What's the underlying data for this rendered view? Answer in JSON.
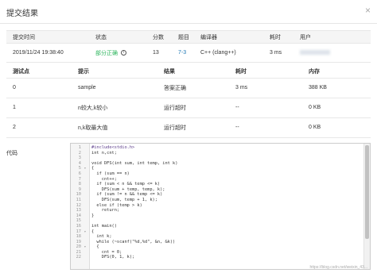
{
  "modal": {
    "title": "提交结果",
    "close": "×"
  },
  "submission": {
    "headers": [
      "提交时间",
      "状态",
      "分数",
      "题目",
      "编译器",
      "耗时",
      "用户"
    ],
    "time": "2019/11/24 19:38:40",
    "status": "部分正确",
    "info_icon": "i",
    "score": "13",
    "problem": "7-3",
    "compiler": "C++ (clang++)",
    "elapsed": "3 ms"
  },
  "cases": {
    "headers": [
      "测试点",
      "提示",
      "结果",
      "耗时",
      "内存"
    ],
    "rows": [
      {
        "id": "0",
        "hint": "sample",
        "result": "答案正确",
        "time": "3 ms",
        "memory": "388 KB"
      },
      {
        "id": "1",
        "hint": "n较大,k较小",
        "result": "运行超时",
        "time": "--",
        "memory": "0 KB"
      },
      {
        "id": "2",
        "hint": "n,k取最大值",
        "result": "运行超时",
        "time": "--",
        "memory": "0 KB"
      }
    ]
  },
  "code": {
    "label": "代码",
    "lines": [
      "#include<stdio.h>",
      "int n,cnt;",
      "",
      "void DFS(int sum, int temp, int k)",
      "{",
      "  if (sum == n)",
      "    cnt++;",
      "  if (sum < n && temp <= k)",
      "    DFS(sum + temp, temp, k);",
      "  if (sum != n && temp <= k)",
      "    DFS(sum, temp + 1, k);",
      "  else if (temp > k)",
      "    return;",
      "}",
      "",
      "int main()",
      "{",
      "  int k;",
      "  while (~scanf(\"%d,%d\", &n, &k))",
      "  {",
      "    cnt = 0;",
      "    DFS(0, 1, k);"
    ],
    "folds": [
      "",
      "",
      "",
      "",
      "▾",
      "",
      "",
      "",
      "",
      "",
      "",
      "",
      "",
      "",
      "",
      "",
      "▾",
      "",
      "",
      "▾",
      "",
      ""
    ]
  },
  "watermark": "https://blog.csdn.net/weixin_43..."
}
